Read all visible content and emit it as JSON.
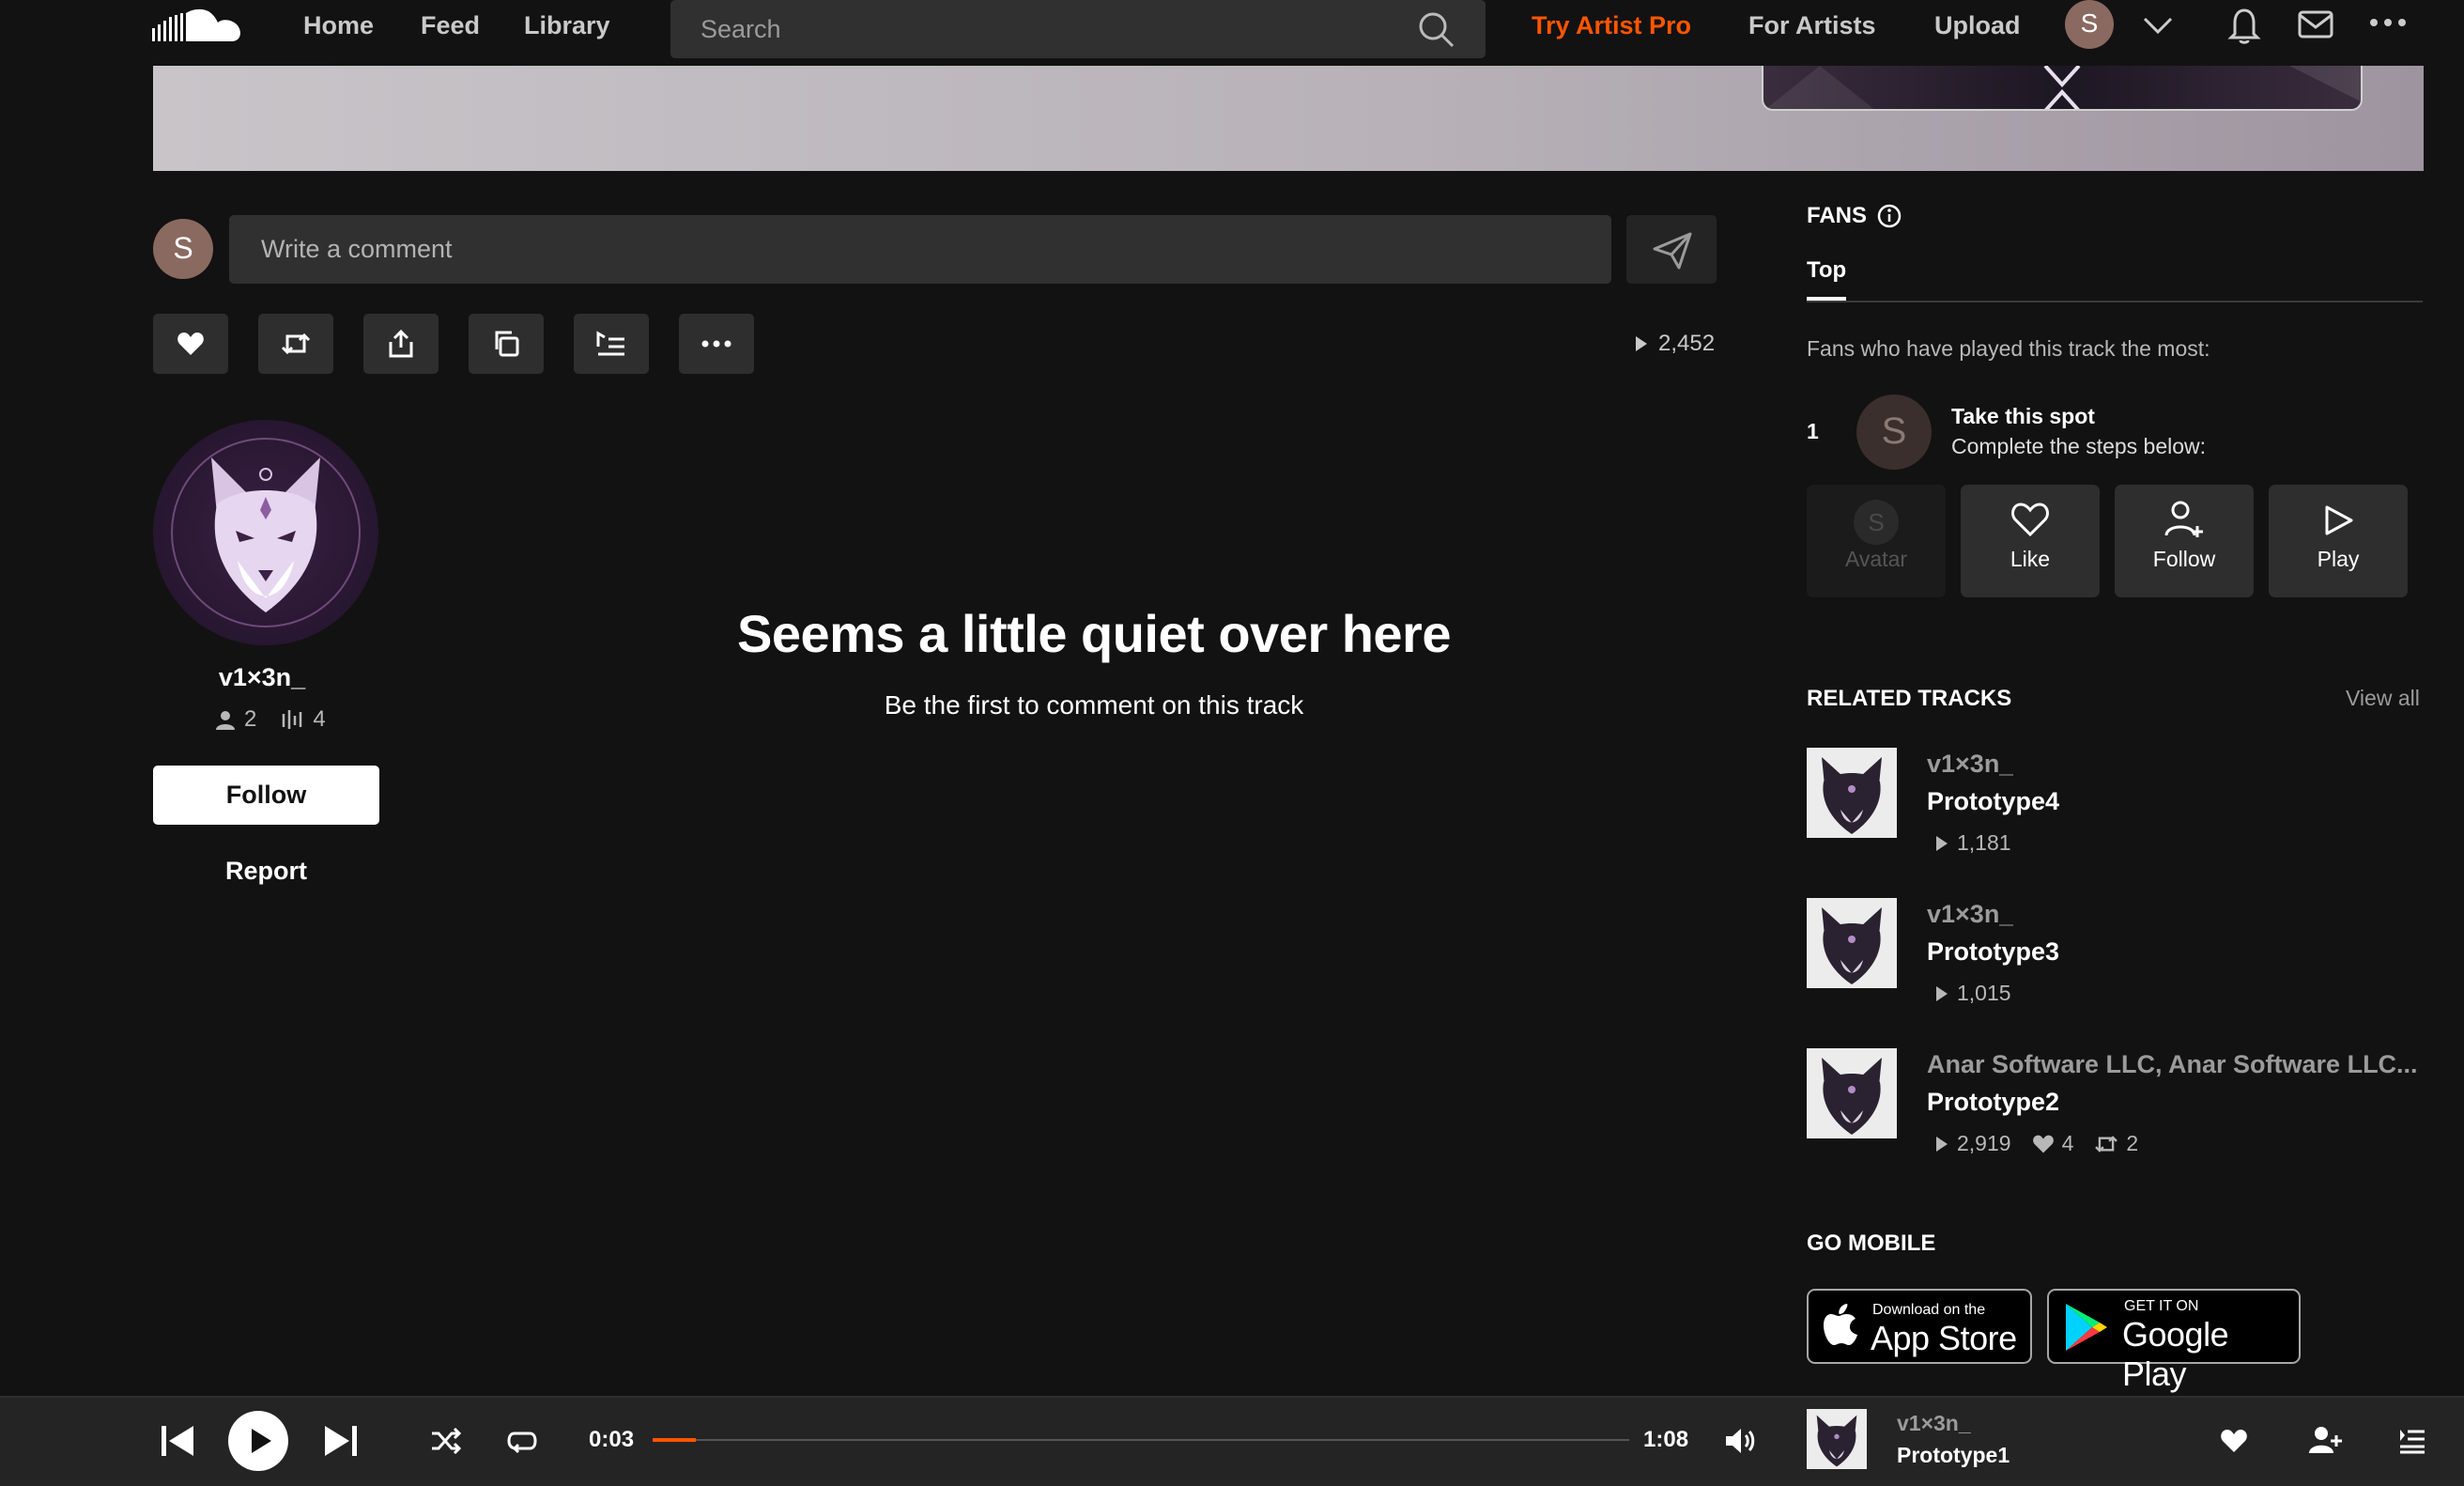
{
  "nav": {
    "links": {
      "home": "Home",
      "feed": "Feed",
      "library": "Library"
    },
    "search_placeholder": "Search",
    "try_pro": "Try Artist Pro",
    "for_artists": "For Artists",
    "upload": "Upload",
    "avatar_initial": "S",
    "accent": "#ff5500"
  },
  "comment": {
    "avatar_initial": "S",
    "placeholder": "Write a comment"
  },
  "actions": {
    "buttons": [
      "like",
      "repost",
      "share",
      "copy-link",
      "add-to-playlist",
      "more"
    ],
    "plays": "2,452"
  },
  "artist": {
    "name": "v1×3n_",
    "followers": "2",
    "tracks": "4",
    "follow_label": "Follow",
    "report_label": "Report"
  },
  "comments_empty": {
    "title": "Seems a little quiet over here",
    "subtitle": "Be the first to comment on this track"
  },
  "fans": {
    "title": "FANS",
    "tab": "Top",
    "description": "Fans who have played this track the most:",
    "rank": "1",
    "spot_initial": "S",
    "spot_title": "Take this spot",
    "spot_sub": "Complete the steps below:",
    "steps": {
      "avatar": "Avatar",
      "like": "Like",
      "follow": "Follow",
      "play": "Play"
    },
    "step_avatar_initial": "S"
  },
  "related": {
    "title": "RELATED TRACKS",
    "view_all": "View all",
    "tracks": [
      {
        "artist": "v1×3n_",
        "title": "Prototype4",
        "plays": "1,181"
      },
      {
        "artist": "v1×3n_",
        "title": "Prototype3",
        "plays": "1,015"
      },
      {
        "artist": "Anar Software LLC, Anar Software LLC...",
        "title": "Prototype2",
        "plays": "2,919",
        "likes": "4",
        "reposts": "2"
      }
    ]
  },
  "mobile": {
    "title": "GO MOBILE",
    "app_store_small": "Download on the",
    "app_store_big": "App Store",
    "google_small": "GET IT ON",
    "google_big": "Google Play"
  },
  "player": {
    "current_time": "0:03",
    "total_time": "1:08",
    "progress_fraction": 0.044,
    "artist": "v1×3n_",
    "title": "Prototype1"
  }
}
